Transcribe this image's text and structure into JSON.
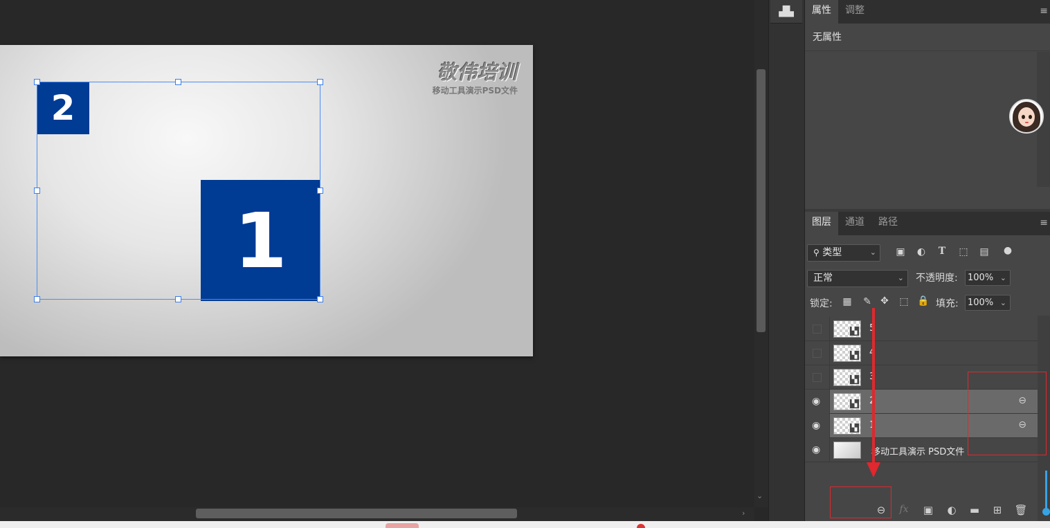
{
  "canvas": {
    "logo_title": "敬伟培训",
    "logo_subtitle": "移动工具演示PSD文件",
    "box_small_label": "2",
    "box_large_label": "1",
    "box_color": "#003b94",
    "selection_color": "#4a8ef5"
  },
  "properties_panel": {
    "tabs": [
      "属性",
      "调整"
    ],
    "empty_text": "无属性"
  },
  "layers_panel": {
    "tabs": [
      "图层",
      "通道",
      "路径"
    ],
    "filter_label": "类型",
    "blend_mode": "正常",
    "opacity_label": "不透明度:",
    "opacity_value": "100%",
    "lock_label": "锁定:",
    "fill_label": "填充:",
    "fill_value": "100%",
    "layers": [
      {
        "name": "5",
        "visible": false,
        "selected": false,
        "linked": false
      },
      {
        "name": "4",
        "visible": false,
        "selected": false,
        "linked": false
      },
      {
        "name": "3",
        "visible": false,
        "selected": false,
        "linked": false
      },
      {
        "name": "2",
        "visible": true,
        "selected": true,
        "linked": true
      },
      {
        "name": "1",
        "visible": true,
        "selected": true,
        "linked": true
      },
      {
        "name": "移动工具演示 PSD文件",
        "visible": true,
        "selected": false,
        "linked": false
      }
    ],
    "footer_icons": [
      "link-icon",
      "fx-icon",
      "mask-icon",
      "adjustment-icon",
      "folder-icon",
      "new-layer-icon",
      "trash-icon"
    ]
  },
  "icons": {
    "histogram": "▟▙",
    "menu": "≡",
    "eye": "👁",
    "link": "⛓",
    "chevron": "⌄"
  },
  "annotation_color": "#e0282e"
}
